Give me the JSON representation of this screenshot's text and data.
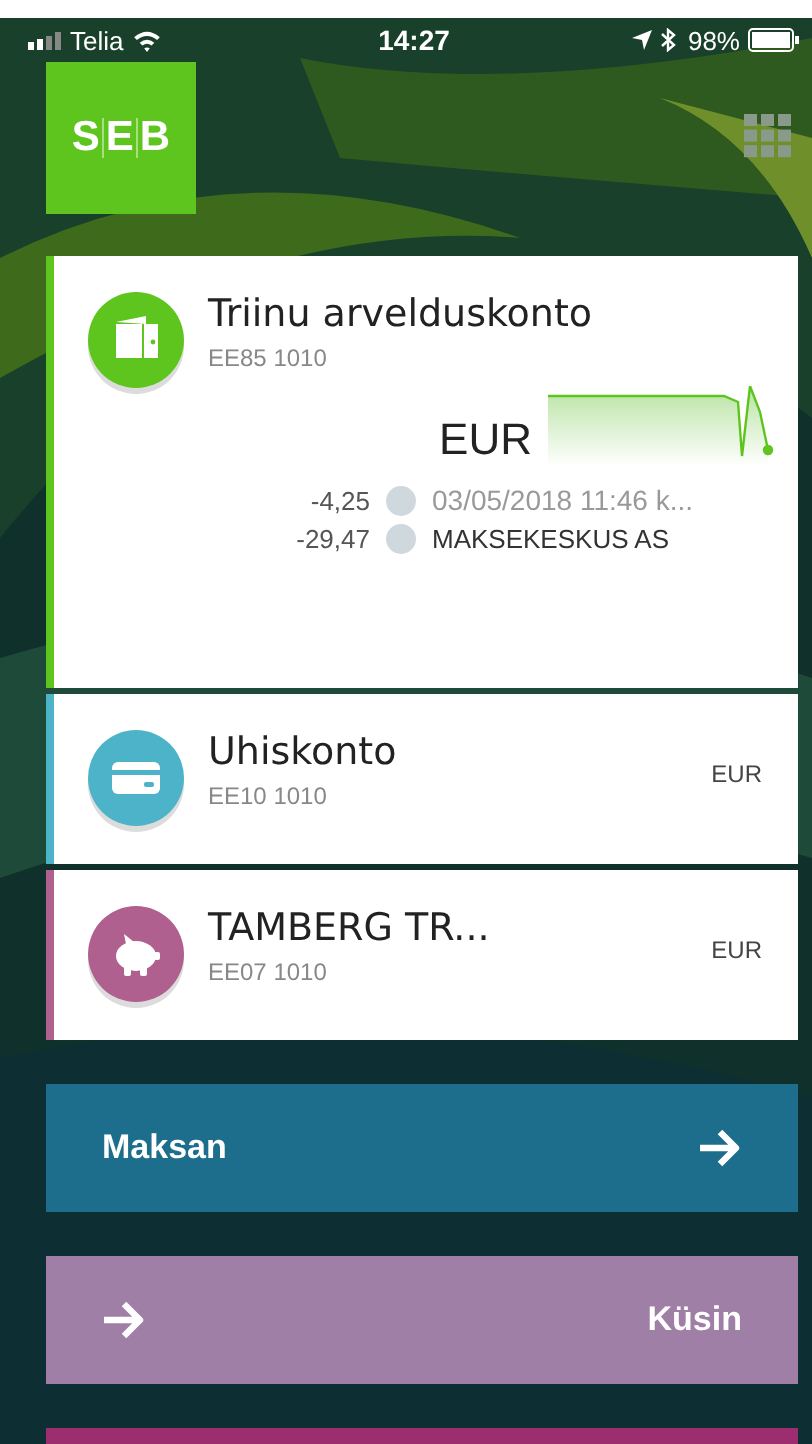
{
  "status_bar": {
    "carrier": "Telia",
    "time": "14:27",
    "battery": "98%"
  },
  "logo": {
    "letters": [
      "S",
      "E",
      "B"
    ]
  },
  "accounts": [
    {
      "kind": "current",
      "name": "Triinu arvelduskonto",
      "iban": "EE85 1010",
      "currency": "EUR",
      "color": "#5ec41e",
      "expanded": true,
      "transactions": [
        {
          "amount": "-4,25",
          "text": "03/05/2018 11:46 k...",
          "pending": true
        },
        {
          "amount": "-29,47",
          "text": "MAKSEKESKUS AS",
          "pending": false
        }
      ]
    },
    {
      "kind": "card",
      "name": "Uhiskonto",
      "iban": "EE10 1010",
      "currency": "EUR",
      "color": "#4db3c9",
      "expanded": false
    },
    {
      "kind": "savings",
      "name": "TAMBERG TR...",
      "iban": "EE07 1010",
      "currency": "EUR",
      "color": "#b0608f",
      "expanded": false
    }
  ],
  "actions": [
    {
      "label": "Maksan",
      "kind": "outgoing",
      "color": "#1d6e8c"
    },
    {
      "label": "Küsin",
      "kind": "incoming",
      "color": "#a07fa6"
    },
    {
      "color": "#9c2d6e"
    }
  ]
}
